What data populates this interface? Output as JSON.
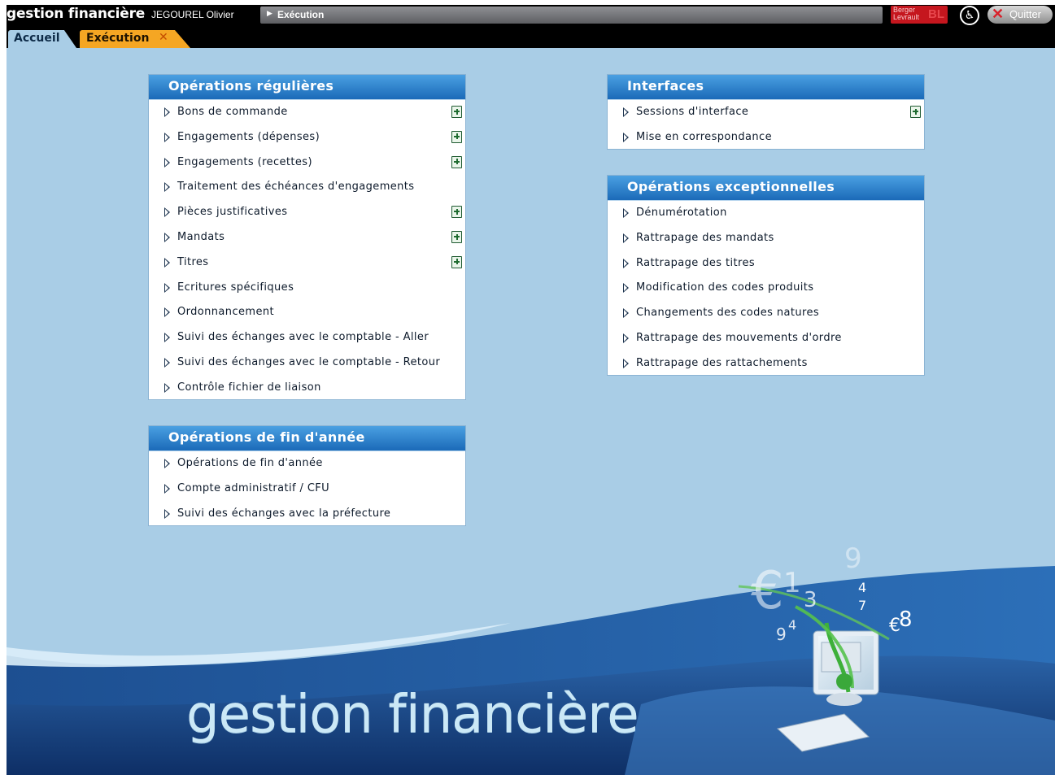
{
  "header": {
    "app_title": "gestion financière",
    "user": "JEGOUREL Olivier",
    "breadcrumb": "Exécution",
    "vendor_logo_text": "Berger Levrault",
    "vendor_logo_mark": "BL",
    "accessibility_icon": "accessibility-icon",
    "quit_label": "Quitter"
  },
  "tabs": [
    {
      "label": "Accueil",
      "active": true
    },
    {
      "label": "Exécution",
      "closable": true,
      "close_glyph": "✕"
    }
  ],
  "panels": {
    "regular": {
      "title": "Opérations régulières",
      "items": [
        {
          "label": "Bons de commande",
          "add": true
        },
        {
          "label": "Engagements (dépenses)",
          "add": true
        },
        {
          "label": "Engagements (recettes)",
          "add": true
        },
        {
          "label": "Traitement des échéances d'engagements",
          "add": false
        },
        {
          "label": "Pièces justificatives",
          "add": true
        },
        {
          "label": "Mandats",
          "add": true
        },
        {
          "label": "Titres",
          "add": true
        },
        {
          "label": "Ecritures spécifiques",
          "add": false
        },
        {
          "label": "Ordonnancement",
          "add": false
        },
        {
          "label": "Suivi des échanges avec le comptable - Aller",
          "add": false
        },
        {
          "label": "Suivi des échanges avec le comptable - Retour",
          "add": false
        },
        {
          "label": "Contrôle fichier de liaison",
          "add": false
        }
      ]
    },
    "year_end": {
      "title": "Opérations de fin d'année",
      "items": [
        {
          "label": "Opérations de fin d'année",
          "add": false
        },
        {
          "label": "Compte administratif / CFU",
          "add": false
        },
        {
          "label": "Suivi des échanges avec la préfecture",
          "add": false
        }
      ]
    },
    "interfaces": {
      "title": "Interfaces",
      "items": [
        {
          "label": "Sessions d'interface",
          "add": true
        },
        {
          "label": "Mise en correspondance",
          "add": false
        }
      ]
    },
    "exceptional": {
      "title": "Opérations exceptionnelles",
      "items": [
        {
          "label": "Dénumérotation",
          "add": false
        },
        {
          "label": "Rattrapage des mandats",
          "add": false
        },
        {
          "label": "Rattrapage des titres",
          "add": false
        },
        {
          "label": "Modification des codes produits",
          "add": false
        },
        {
          "label": "Changements des codes natures",
          "add": false
        },
        {
          "label": "Rattrapage des mouvements d'ordre",
          "add": false
        },
        {
          "label": "Rattrapage des rattachements",
          "add": false
        }
      ]
    }
  },
  "branding": {
    "text": "gestion financière",
    "glyphs": [
      "€",
      "1",
      "3",
      "9",
      "4",
      "7",
      "€",
      "8",
      "9",
      "4"
    ]
  },
  "colors": {
    "background": "#a9cde6",
    "panel_header": "#1b6ab8",
    "active_tab": "#f5a623"
  }
}
